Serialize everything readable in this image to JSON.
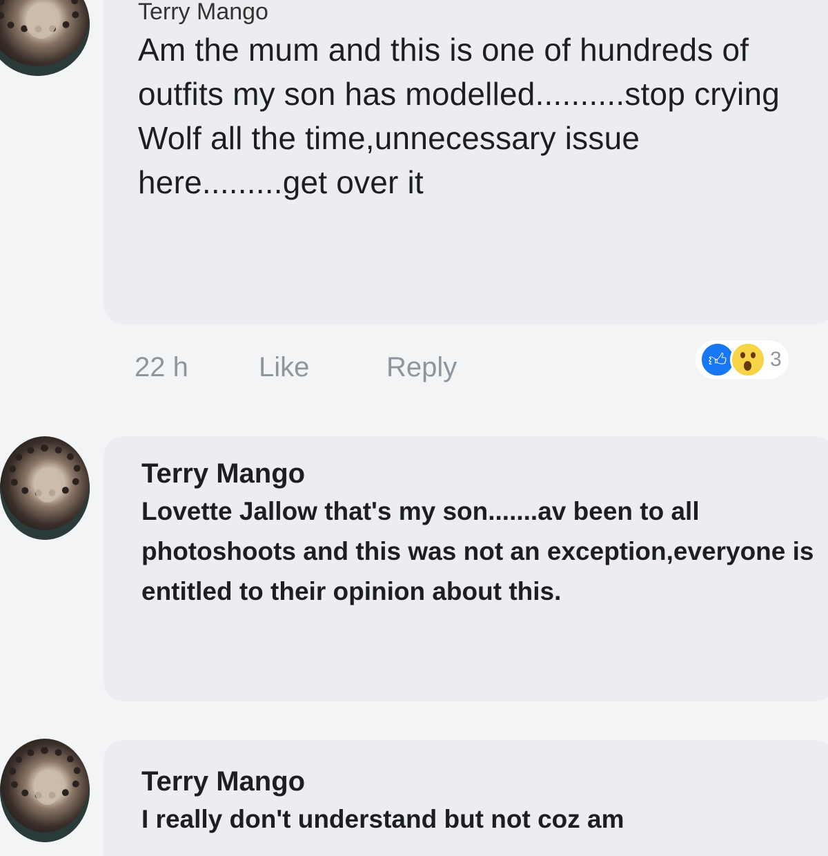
{
  "comments": [
    {
      "author": "Terry Mango",
      "text": "Am the mum and this is one of hundreds of outfits my son has modelled..........stop crying Wolf all the time,unnecessary issue here.........get over it",
      "time": "22 h",
      "like_label": "Like",
      "reply_label": "Reply",
      "reactions": {
        "icons": [
          "like-icon",
          "wow-icon"
        ],
        "count": "3"
      }
    },
    {
      "author": "Terry Mango",
      "text": "Lovette Jallow that's my son.......av been to all photoshoots and this was not an exception,everyone is entitled to their opinion about this."
    },
    {
      "author": "Terry Mango",
      "text": "I really don't understand but not coz am"
    }
  ],
  "colors": {
    "bubble": "#ebedf0",
    "meta_text": "#90949c",
    "like_blue": "#1877f2",
    "wow_yellow": "#f7d445"
  }
}
